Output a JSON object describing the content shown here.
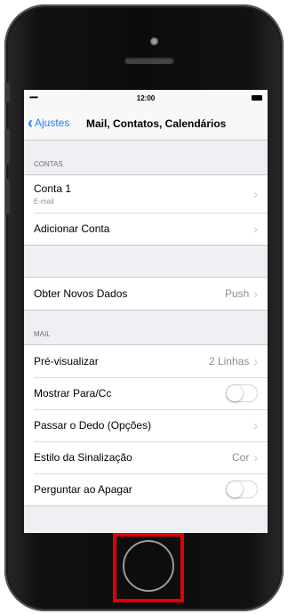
{
  "status_bar": {
    "signal": "•••••",
    "time": "12:00"
  },
  "nav": {
    "back_label": "Ajustes",
    "title": "Mail, Contatos, Calendários"
  },
  "sections": {
    "contas_header": "CONTAS",
    "mail_header": "MAIL"
  },
  "accounts": {
    "conta1_label": "Conta 1",
    "conta1_sub": "E-mail",
    "add_label": "Adicionar Conta"
  },
  "fetch": {
    "label": "Obter Novos Dados",
    "value": "Push"
  },
  "mail": {
    "preview_label": "Pré-visualizar",
    "preview_value": "2 Linhas",
    "show_to_cc_label": "Mostrar Para/Cc",
    "show_to_cc_on": false,
    "swipe_label": "Passar o Dedo (Opções)",
    "flag_style_label": "Estilo da Sinalização",
    "flag_style_value": "Cor",
    "ask_delete_label": "Perguntar ao Apagar",
    "ask_delete_on": false
  },
  "colors": {
    "accent": "#1e7efb",
    "highlight": "#e00000"
  },
  "icons": {
    "back": "chevron-left-icon",
    "disclosure": "chevron-right-icon"
  }
}
